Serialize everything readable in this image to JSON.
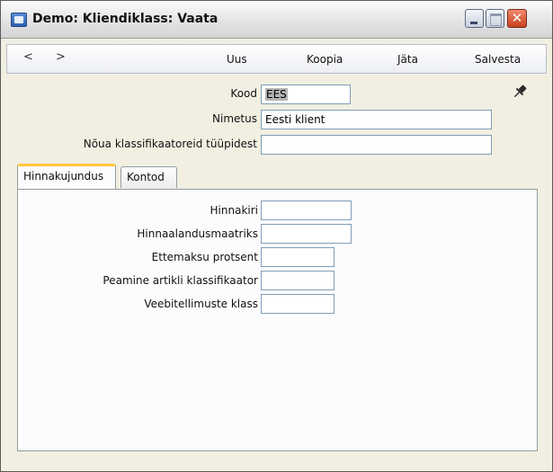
{
  "window": {
    "title": "Demo: Kliendiklass: Vaata",
    "close_glyph": "✕"
  },
  "toolbar": {
    "back_label": "<",
    "forward_label": ">",
    "new_label": "Uus",
    "copy_label": "Koopia",
    "cancel_label": "Jäta",
    "save_label": "Salvesta"
  },
  "form": {
    "code_label": "Kood",
    "code_value": "EES",
    "name_label": "Nimetus",
    "name_value": "Eesti klient",
    "require_label": "Nõua klassifikaatoreid tüüpidest",
    "require_value": ""
  },
  "tabs": [
    {
      "label": "Hinnakujundus"
    },
    {
      "label": "Kontod"
    }
  ],
  "pricing": {
    "price_list_label": "Hinnakiri",
    "price_list_value": "",
    "discount_matrix_label": "Hinnaalandusmaatriks",
    "discount_matrix_value": "",
    "prepayment_label": "Ettemaksu protsent",
    "prepayment_value": "",
    "main_item_class_label": "Peamine artikli klassifikaator",
    "main_item_class_value": "",
    "web_order_class_label": "Veebitellimuste klass",
    "web_order_class_value": ""
  },
  "icons": {
    "app": "window-app-icon",
    "pin": "pin-icon"
  }
}
